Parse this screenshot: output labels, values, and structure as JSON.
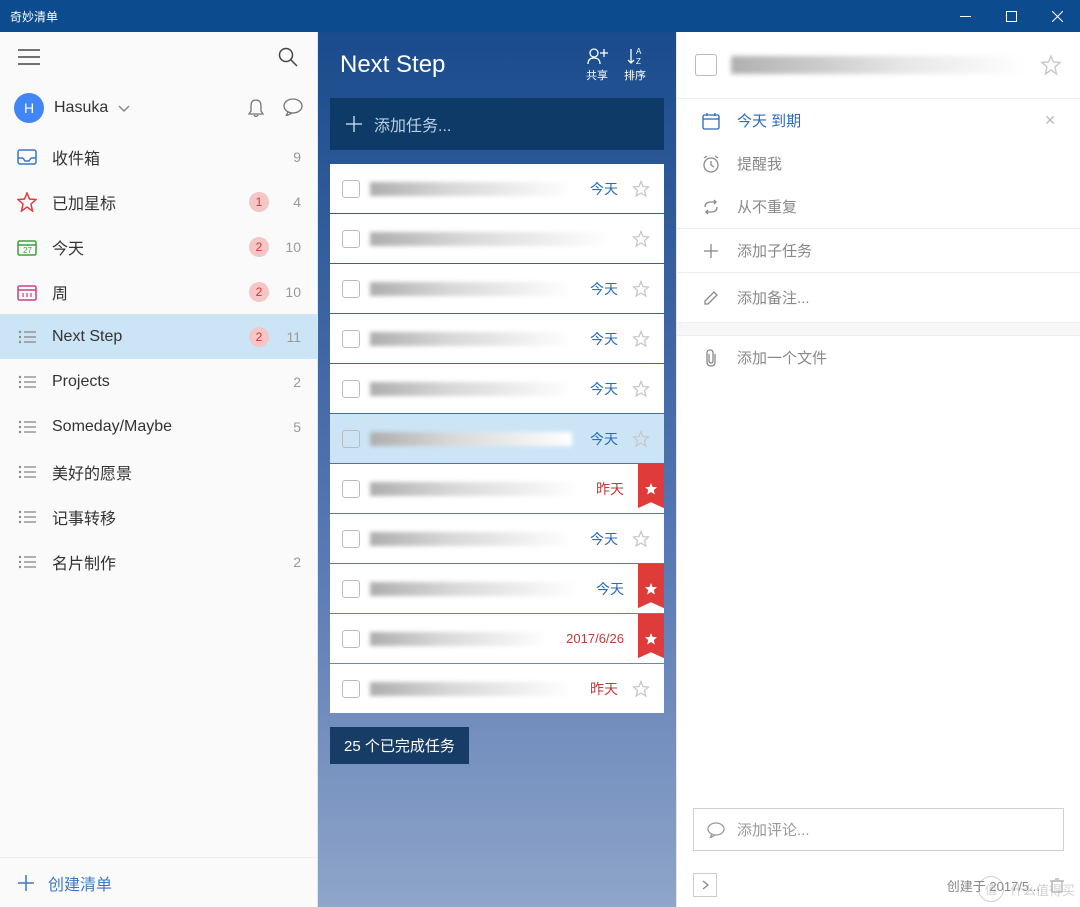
{
  "window": {
    "title": "奇妙清单"
  },
  "user": {
    "initial": "H",
    "name": "Hasuka"
  },
  "sidebar": {
    "items": [
      {
        "icon": "inbox",
        "label": "收件箱",
        "badge": null,
        "count": "9"
      },
      {
        "icon": "star",
        "label": "已加星标",
        "badge": "1",
        "count": "4"
      },
      {
        "icon": "today",
        "label": "今天",
        "badge": "2",
        "count": "10"
      },
      {
        "icon": "week",
        "label": "周",
        "badge": "2",
        "count": "10"
      },
      {
        "icon": "list",
        "label": "Next Step",
        "badge": "2",
        "count": "11",
        "active": true
      },
      {
        "icon": "list",
        "label": "Projects",
        "badge": null,
        "count": "2"
      },
      {
        "icon": "list",
        "label": "Someday/Maybe",
        "badge": null,
        "count": "5"
      },
      {
        "icon": "list",
        "label": "美好的愿景",
        "badge": null,
        "count": ""
      },
      {
        "icon": "list",
        "label": "记事转移",
        "badge": null,
        "count": ""
      },
      {
        "icon": "list",
        "label": "名片制作",
        "badge": null,
        "count": "2"
      }
    ],
    "create": "创建清单"
  },
  "mid": {
    "title": "Next Step",
    "share": "共享",
    "sort": "排序",
    "add_placeholder": "添加任务...",
    "tasks": [
      {
        "date": "今天",
        "dateClass": "today",
        "star": false,
        "selected": false
      },
      {
        "date": "",
        "dateClass": "",
        "star": false,
        "selected": false
      },
      {
        "date": "今天",
        "dateClass": "today",
        "star": false,
        "selected": false
      },
      {
        "date": "今天",
        "dateClass": "today",
        "star": false,
        "selected": false
      },
      {
        "date": "今天",
        "dateClass": "today",
        "star": false,
        "selected": false
      },
      {
        "date": "今天",
        "dateClass": "today",
        "star": false,
        "selected": true
      },
      {
        "date": "昨天",
        "dateClass": "past",
        "star": true,
        "selected": false
      },
      {
        "date": "今天",
        "dateClass": "today",
        "star": false,
        "selected": false
      },
      {
        "date": "今天",
        "dateClass": "today",
        "star": true,
        "selected": false
      },
      {
        "date": "2017/6/26",
        "dateClass": "custom",
        "star": true,
        "selected": false
      },
      {
        "date": "昨天",
        "dateClass": "past",
        "star": false,
        "selected": false
      }
    ],
    "completed_count": "25",
    "completed_label": "个已完成任务"
  },
  "detail": {
    "due": "今天 到期",
    "remind": "提醒我",
    "repeat": "从不重复",
    "subtask": "添加子任务",
    "note": "添加备注...",
    "file": "添加一个文件",
    "comment": "添加评论...",
    "created": "创建于 2017/5..."
  },
  "watermark": {
    "circle": "值",
    "text": "什么值得买"
  }
}
